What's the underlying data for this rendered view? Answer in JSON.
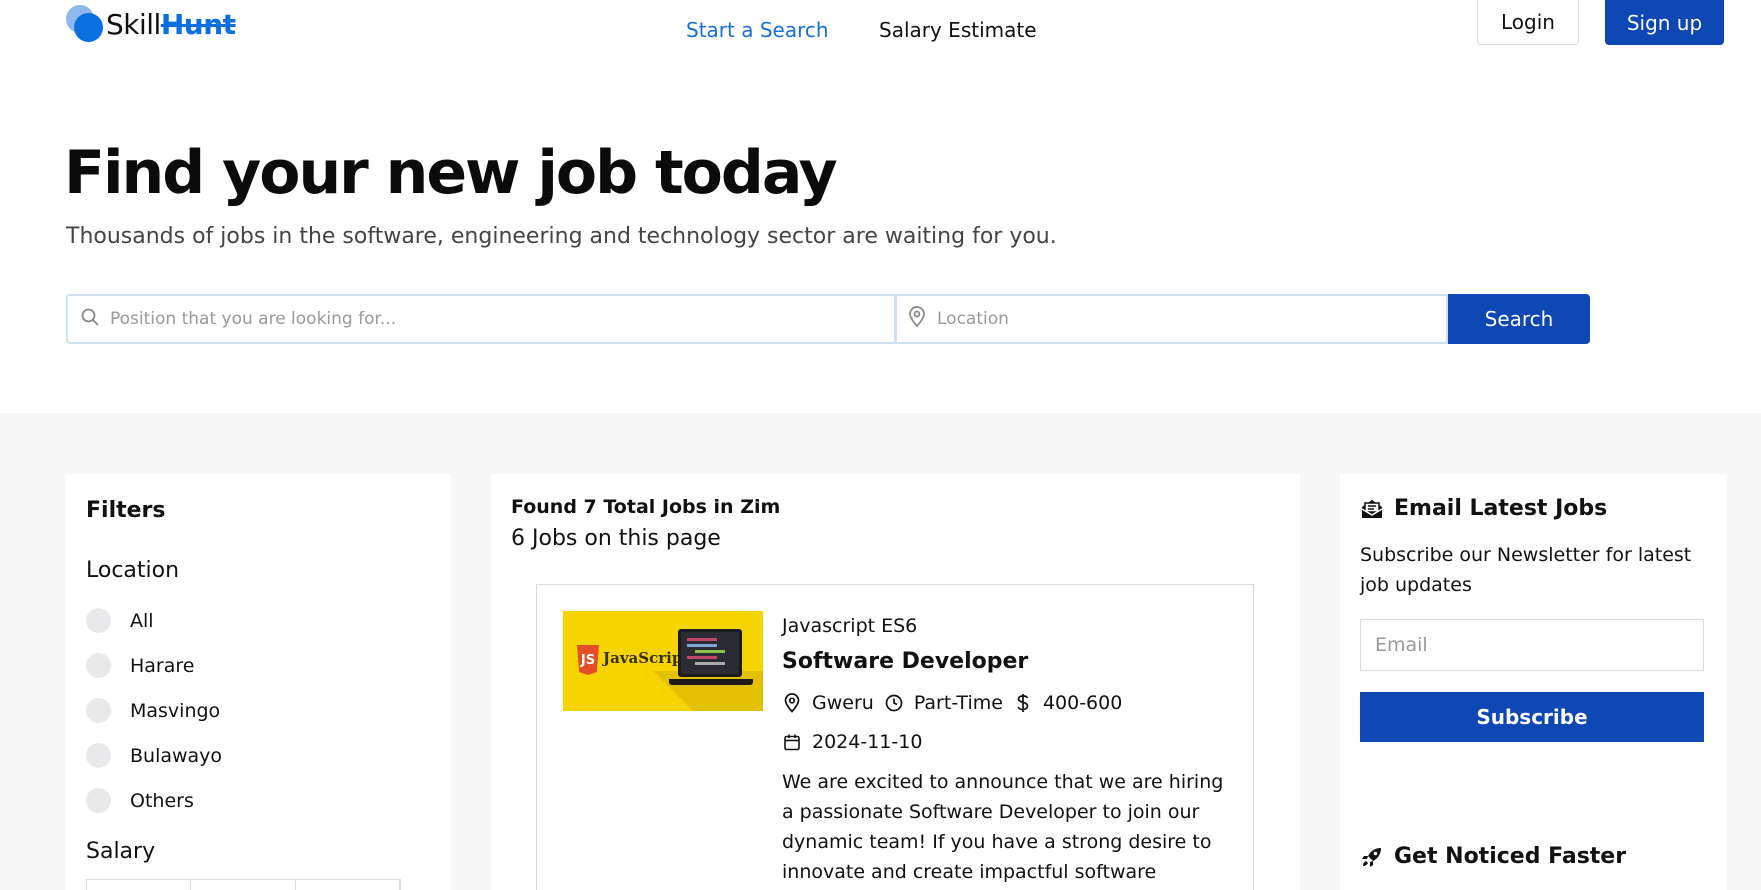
{
  "brand": {
    "name_part1": "Skill",
    "name_part2": "Hunt",
    "accent": "#0a6fe0"
  },
  "nav": {
    "links": [
      {
        "label": "Start a Search"
      },
      {
        "label": "Salary Estimate"
      }
    ],
    "login_label": "Login",
    "signup_label": "Sign up"
  },
  "hero": {
    "title": "Find your new job today",
    "subtitle": "Thousands of jobs in the software, engineering and technology sector are waiting for you.",
    "position_placeholder": "Position that you are looking for...",
    "location_placeholder": "Location",
    "search_label": "Search"
  },
  "filters": {
    "title": "Filters",
    "location_title": "Location",
    "locations": [
      "All",
      "Harare",
      "Masvingo",
      "Bulawayo",
      "Others"
    ],
    "salary_title": "Salary"
  },
  "jobs": {
    "found_text": "Found 7 Total Jobs in Zim",
    "page_text": "6 Jobs on this page",
    "items": [
      {
        "tag": "Javascript ES6",
        "title": "Software Developer",
        "location": "Gweru",
        "type": "Part-Time",
        "salary": "400-600",
        "date": "2024-11-10",
        "thumb_badge": "JS",
        "thumb_text": "JavaScript",
        "description": "We are excited to announce that we are hiring a passionate Software Developer to join our dynamic team! If you have a strong desire to innovate and create impactful software"
      }
    ]
  },
  "sidebar": {
    "email_title": "Email Latest Jobs",
    "email_desc": "Subscribe our Newsletter for latest job updates",
    "email_placeholder": "Email",
    "subscribe_label": "Subscribe",
    "noticed_title": "Get Noticed Faster"
  },
  "colors": {
    "primary": "#0d47b3",
    "link": "#1570d6",
    "section_bg": "#f7f7f7"
  }
}
